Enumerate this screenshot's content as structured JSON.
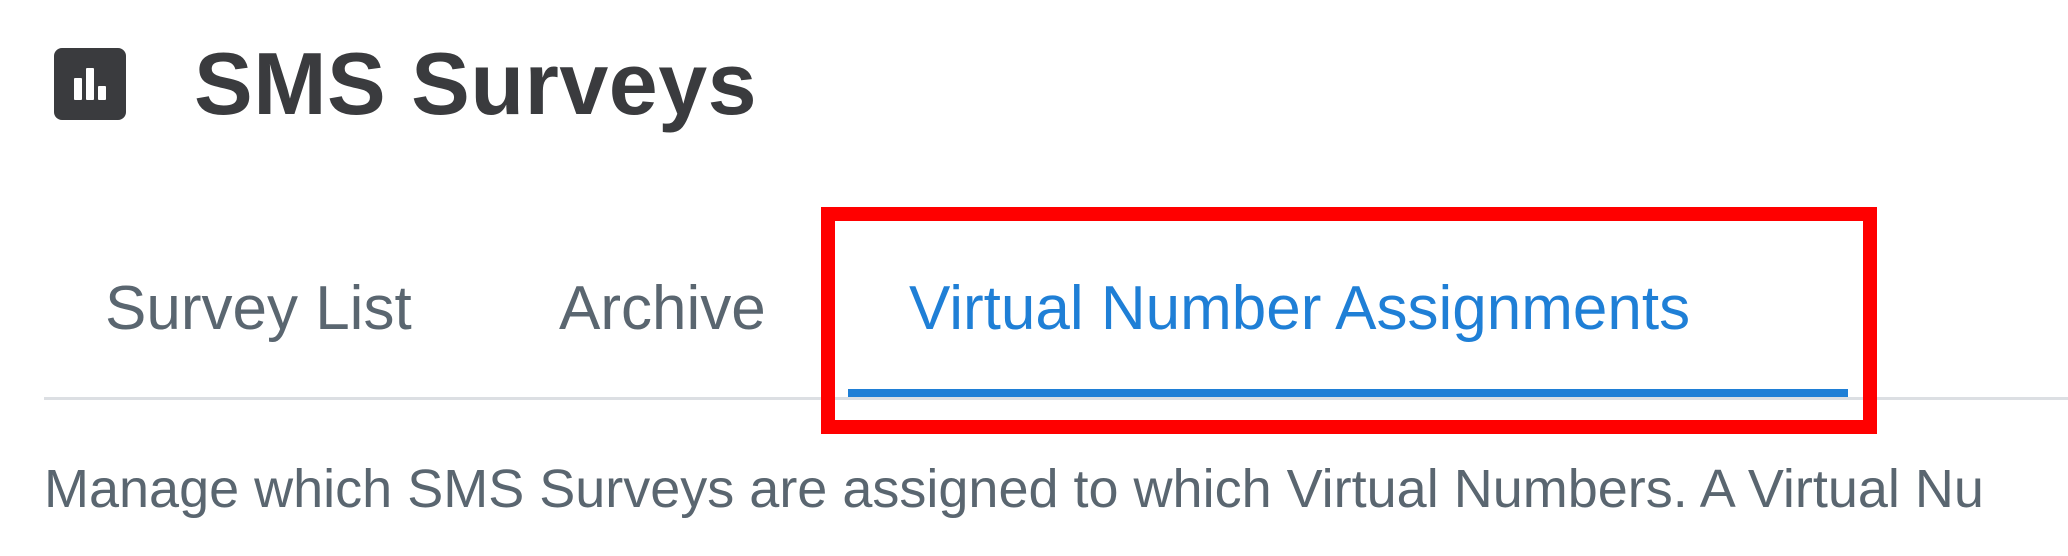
{
  "header": {
    "icon": "bar-chart-icon",
    "title": "SMS Surveys"
  },
  "tabs": [
    {
      "label": "Survey List",
      "active": false
    },
    {
      "label": "Archive",
      "active": false
    },
    {
      "label": "Virtual Number Assignments",
      "active": true
    }
  ],
  "description": "Manage which SMS Surveys are assigned to which Virtual Numbers. A Virtual Nu",
  "colors": {
    "accent": "#1f7fd6",
    "title": "#3a3b3e",
    "tab_inactive": "#5a6670",
    "highlight": "#ff0000"
  }
}
